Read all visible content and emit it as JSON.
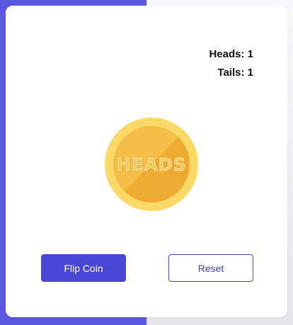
{
  "scoreboard": {
    "heads_label": "Heads:",
    "heads_count": "1",
    "tails_label": "Tails:",
    "tails_count": "1"
  },
  "coin": {
    "face_text": "HEADS",
    "icon": "coin-icon",
    "colors": {
      "rim": "#fbd966",
      "face": "#eeab32",
      "highlight": "#f5c451"
    }
  },
  "actions": {
    "flip_label": "Flip Coin",
    "reset_label": "Reset"
  },
  "theme": {
    "accent": "#4946d6",
    "background_left": "#5b57e0",
    "card": "#ffffff"
  }
}
